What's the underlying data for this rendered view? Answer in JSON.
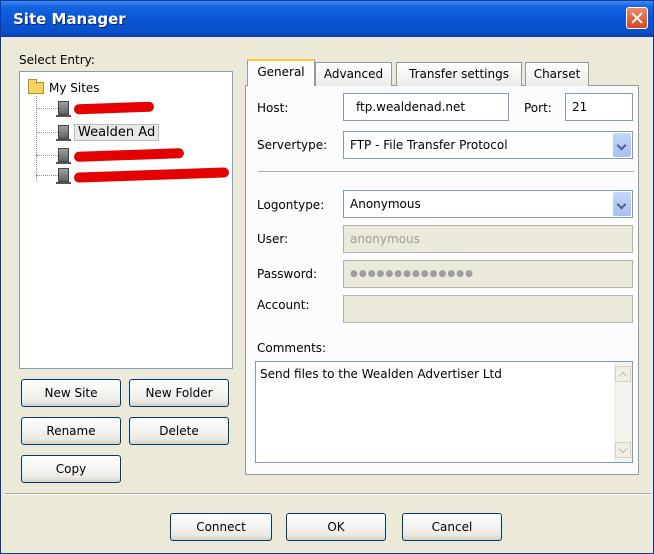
{
  "window": {
    "title": "Site Manager",
    "close_icon": "close-icon"
  },
  "left": {
    "select_label": "Select Entry:",
    "root_label": "My Sites",
    "sites": [
      {
        "label": "",
        "redacted": true
      },
      {
        "label": "Wealden Ad",
        "redacted": false
      },
      {
        "label": "",
        "redacted": true
      },
      {
        "label": "",
        "redacted": true
      }
    ],
    "buttons": {
      "new_site": "New Site",
      "new_folder": "New Folder",
      "rename": "Rename",
      "delete": "Delete",
      "copy": "Copy"
    }
  },
  "tabs": [
    "General",
    "Advanced",
    "Transfer settings",
    "Charset"
  ],
  "general": {
    "host_label": "Host:",
    "host_value": "ftp.wealdenad.net",
    "port_label": "Port:",
    "port_value": "21",
    "servertype_label": "Servertype:",
    "servertype_value": "FTP - File Transfer Protocol",
    "logontype_label": "Logontype:",
    "logontype_value": "Anonymous",
    "user_label": "User:",
    "user_value": "anonymous",
    "password_label": "Password:",
    "password_value": "●●●●●●●●●●●●●●",
    "account_label": "Account:",
    "account_value": "",
    "comments_label": "Comments:",
    "comments_value": "Send files to the Wealden Advertiser Ltd"
  },
  "footer": {
    "connect": "Connect",
    "ok": "OK",
    "cancel": "Cancel"
  },
  "colors": {
    "titlebar": "#0a56d6",
    "active_tab": "#ffc83c",
    "redaction": "#e40000"
  }
}
